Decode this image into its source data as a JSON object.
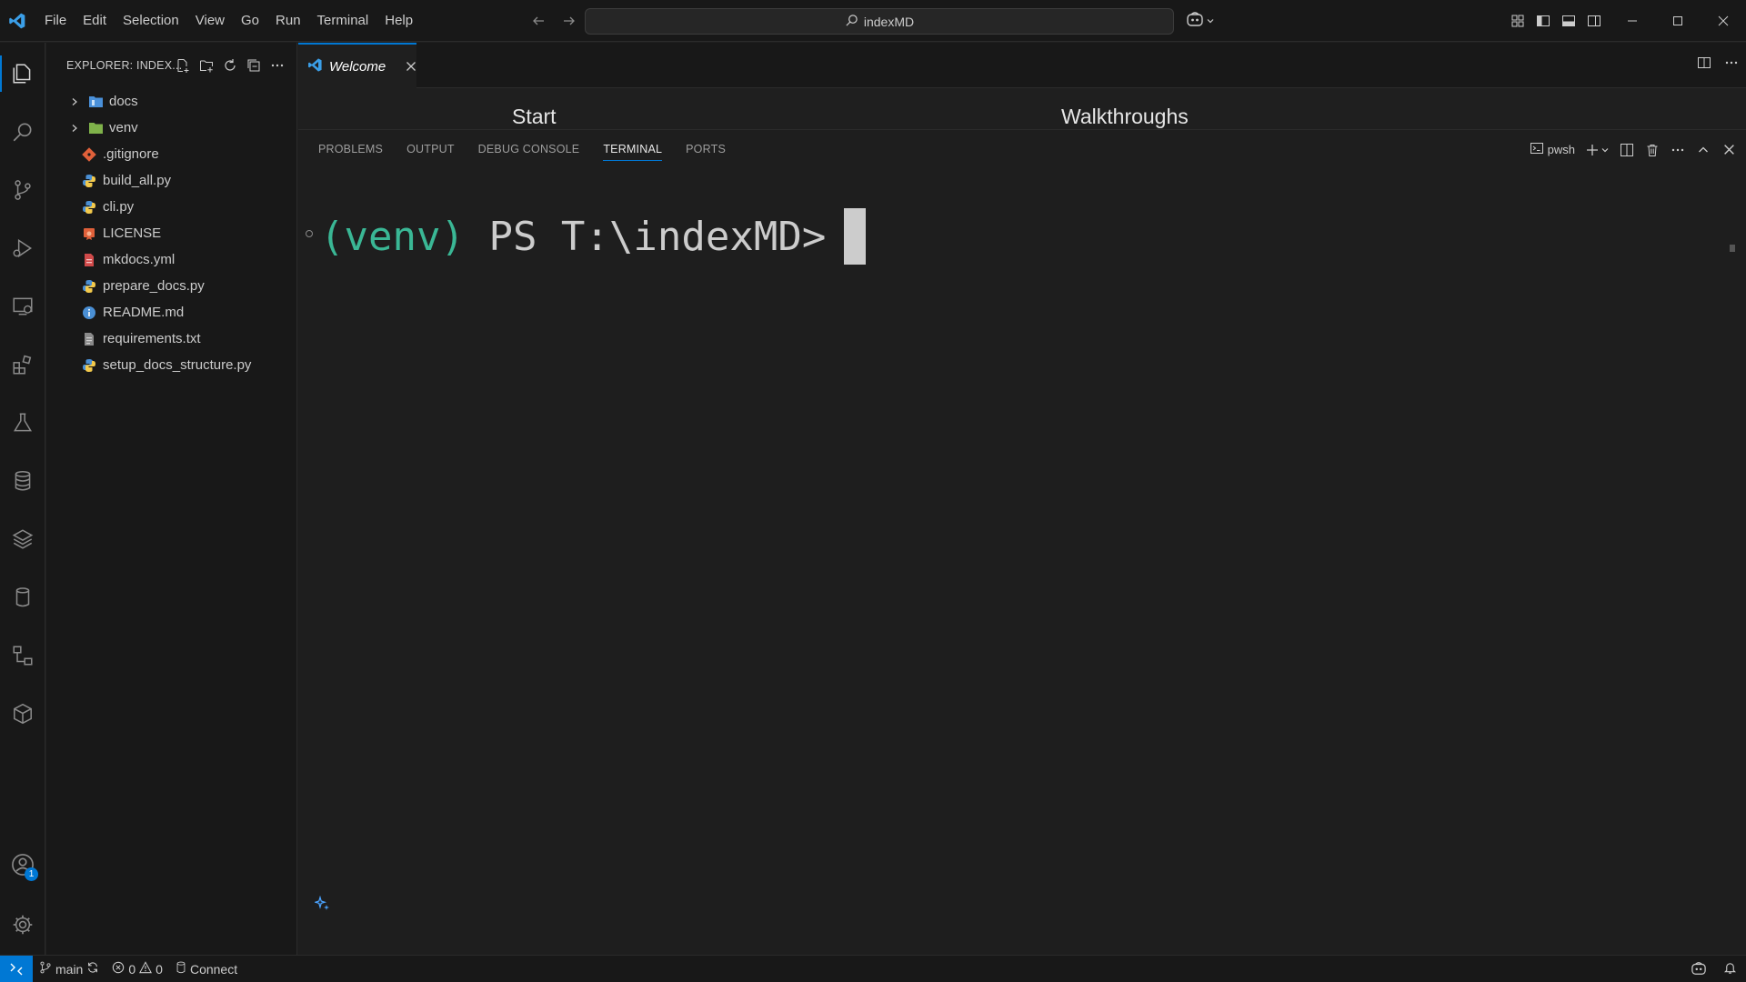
{
  "titlebar": {
    "menu": [
      "File",
      "Edit",
      "Selection",
      "View",
      "Go",
      "Run",
      "Terminal",
      "Help"
    ],
    "search_text": "indexMD"
  },
  "sidebar": {
    "title": "EXPLORER: INDEX...",
    "tree": [
      {
        "label": "docs",
        "type": "folder",
        "icon": "folder-docs-icon",
        "color": "#4a90d9"
      },
      {
        "label": "venv",
        "type": "folder",
        "icon": "folder-venv-icon",
        "color": "#7fb24a"
      },
      {
        "label": ".gitignore",
        "type": "file",
        "icon": "git-file-icon",
        "color": "#e0603a"
      },
      {
        "label": "build_all.py",
        "type": "file",
        "icon": "python-file-icon",
        "color": "#4a8fd4"
      },
      {
        "label": "cli.py",
        "type": "file",
        "icon": "python-file-icon",
        "color": "#4a8fd4"
      },
      {
        "label": "LICENSE",
        "type": "file",
        "icon": "license-file-icon",
        "color": "#e0603a"
      },
      {
        "label": "mkdocs.yml",
        "type": "file",
        "icon": "yaml-file-icon",
        "color": "#d04a4a"
      },
      {
        "label": "prepare_docs.py",
        "type": "file",
        "icon": "python-file-icon",
        "color": "#4a8fd4"
      },
      {
        "label": "README.md",
        "type": "file",
        "icon": "info-file-icon",
        "color": "#4a8fd4"
      },
      {
        "label": "requirements.txt",
        "type": "file",
        "icon": "text-file-icon",
        "color": "#8a8a8a"
      },
      {
        "label": "setup_docs_structure.py",
        "type": "file",
        "icon": "python-file-icon",
        "color": "#4a8fd4"
      }
    ]
  },
  "editor": {
    "tab_label": "Welcome",
    "start_heading": "Start",
    "walkthroughs_heading": "Walkthroughs"
  },
  "panel": {
    "tabs": [
      "PROBLEMS",
      "OUTPUT",
      "DEBUG CONSOLE",
      "TERMINAL",
      "PORTS"
    ],
    "active_tab": "TERMINAL",
    "shell_label": "pwsh"
  },
  "terminal": {
    "venv": "(venv)",
    "prompt": "PS T:\\indexMD>"
  },
  "activity": {
    "accounts_badge": "1"
  },
  "statusbar": {
    "branch": "main",
    "errors": "0",
    "warnings": "0",
    "connect": "Connect"
  },
  "colors": {
    "accent": "#0078d4",
    "venv_green": "#3ab795"
  }
}
